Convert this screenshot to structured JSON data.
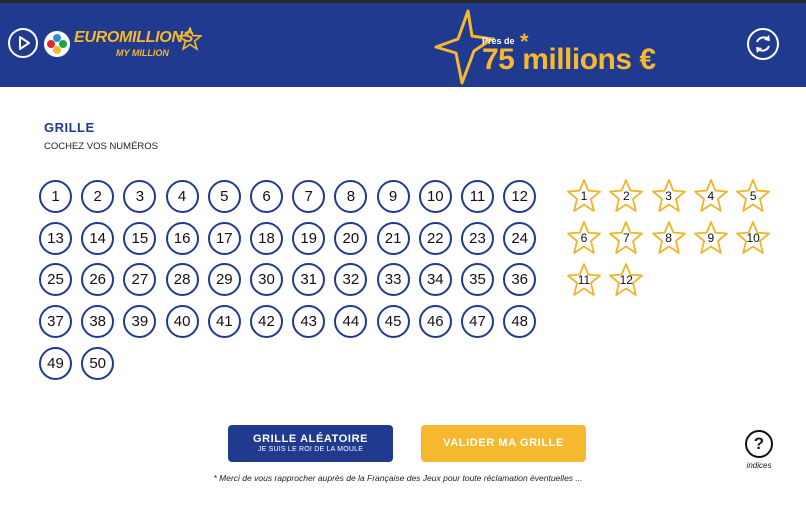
{
  "header": {
    "logo_main": "EUROMILLIONS",
    "logo_sub": "MY MILLION",
    "jackpot_prefix": "Près de",
    "jackpot_amount": "75 millions €",
    "jackpot_asterisk": "*",
    "play_icon": "play-icon",
    "refresh_icon": "refresh-icon",
    "colors": {
      "background": "#203a8f",
      "accent": "#f5b82e"
    }
  },
  "grid": {
    "title": "GRILLE",
    "subtitle": "COCHEZ VOS NUMÉROS",
    "numbers": [
      "1",
      "2",
      "3",
      "4",
      "5",
      "6",
      "7",
      "8",
      "9",
      "10",
      "11",
      "12",
      "13",
      "14",
      "15",
      "16",
      "17",
      "18",
      "19",
      "20",
      "21",
      "22",
      "23",
      "24",
      "25",
      "26",
      "27",
      "28",
      "29",
      "30",
      "31",
      "32",
      "33",
      "34",
      "35",
      "36",
      "37",
      "38",
      "39",
      "40",
      "41",
      "42",
      "43",
      "44",
      "45",
      "46",
      "47",
      "48",
      "49",
      "50"
    ],
    "stars": [
      "1",
      "2",
      "3",
      "4",
      "5",
      "6",
      "7",
      "8",
      "9",
      "10",
      "11",
      "12"
    ]
  },
  "actions": {
    "random_label": "GRILLE ALÉATOIRE",
    "random_sublabel": "JE SUIS LE ROI DE LA MOULE",
    "validate_label": "VALIDER MA GRILLE",
    "help_symbol": "?",
    "help_label": "indices"
  },
  "footnote": "* Merci de vous rapprocher auprès de la Française des Jeux pour toute réclamation éventuelles ..."
}
